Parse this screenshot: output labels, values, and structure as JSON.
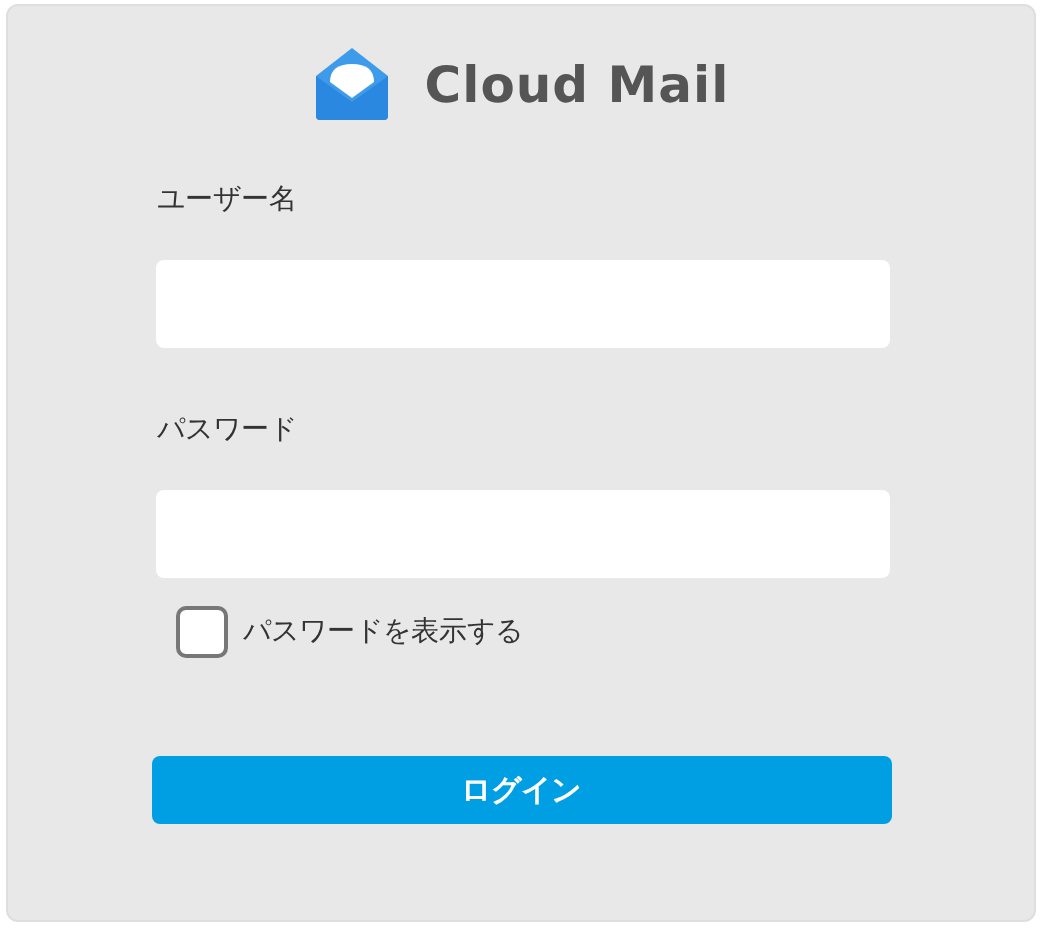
{
  "logo": {
    "text": "Cloud Mail"
  },
  "fields": [
    {
      "label": "ユーザー名"
    },
    {
      "label": "パスワード"
    }
  ],
  "show_password": {
    "label": "パスワードを表示する",
    "checked": false
  },
  "login_button": {
    "label": "ログイン"
  }
}
